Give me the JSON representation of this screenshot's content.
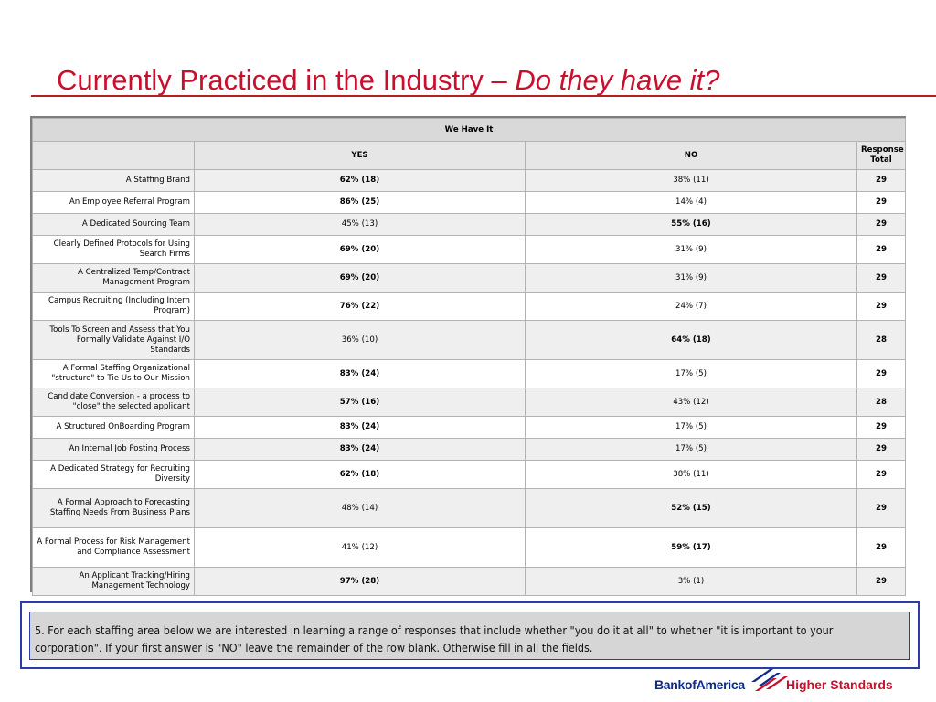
{
  "title": {
    "main": "Currently Practiced in the Industry – ",
    "italic": "Do they have it?"
  },
  "table": {
    "group_header": "We Have It",
    "columns": {
      "yes": "YES",
      "no": "NO",
      "total": "Response Total"
    },
    "rows": [
      {
        "label": "A Staffing Brand",
        "yes": "62% (18)",
        "no": "38% (11)",
        "total": "29",
        "bold": "yes"
      },
      {
        "label": "An Employee Referral Program",
        "yes": "86% (25)",
        "no": "14% (4)",
        "total": "29",
        "bold": "yes"
      },
      {
        "label": "A Dedicated Sourcing Team",
        "yes": "45% (13)",
        "no": "55% (16)",
        "total": "29",
        "bold": "no"
      },
      {
        "label": "Clearly Defined Protocols for Using Search Firms",
        "yes": "69% (20)",
        "no": "31% (9)",
        "total": "29",
        "bold": "yes"
      },
      {
        "label": "A Centralized Temp/Contract Management Program",
        "yes": "69% (20)",
        "no": "31% (9)",
        "total": "29",
        "bold": "yes"
      },
      {
        "label": "Campus Recruiting (Including Intern Program)",
        "yes": "76% (22)",
        "no": "24% (7)",
        "total": "29",
        "bold": "yes"
      },
      {
        "label": "Tools To Screen and Assess that You Formally Validate Against I/O Standards",
        "yes": "36% (10)",
        "no": "64% (18)",
        "total": "28",
        "bold": "no"
      },
      {
        "label": "A Formal Staffing Organizational \"structure\" to Tie Us to Our Mission",
        "yes": "83% (24)",
        "no": "17% (5)",
        "total": "29",
        "bold": "yes"
      },
      {
        "label": "Candidate Conversion - a process to \"close\" the selected applicant",
        "yes": "57% (16)",
        "no": "43% (12)",
        "total": "28",
        "bold": "yes"
      },
      {
        "label": "A Structured OnBoarding Program",
        "yes": "83% (24)",
        "no": "17% (5)",
        "total": "29",
        "bold": "yes"
      },
      {
        "label": "An Internal Job Posting Process",
        "yes": "83% (24)",
        "no": "17% (5)",
        "total": "29",
        "bold": "yes"
      },
      {
        "label": "A Dedicated Strategy for Recruiting Diversity",
        "yes": "62% (18)",
        "no": "38% (11)",
        "total": "29",
        "bold": "yes"
      },
      {
        "label": "A Formal Approach to Forecasting Staffing Needs From Business Plans",
        "yes": "48% (14)",
        "no": "52% (15)",
        "total": "29",
        "bold": "no"
      },
      {
        "label": "A Formal Process for Risk Management and Compliance Assessment",
        "yes": "41% (12)",
        "no": "59% (17)",
        "total": "29",
        "bold": "no"
      },
      {
        "label": "An Applicant Tracking/Hiring Management Technology",
        "yes": "97% (28)",
        "no": "3% (1)",
        "total": "29",
        "bold": "yes"
      }
    ]
  },
  "question": "5. For each staffing area below we are interested in learning a range of responses that include whether \"you do it at all\" to whether \"it is important to your corporation\". If your first answer is \"NO\" leave the remainder of the row blank. Otherwise fill in all the fields.",
  "footer": {
    "brand": "BankofAmerica",
    "tagline": "Higher Standards",
    "logo_icon": "bank-of-america-flag-icon",
    "brand_color": "#0a2a8c",
    "accent_color": "#c8102e"
  }
}
